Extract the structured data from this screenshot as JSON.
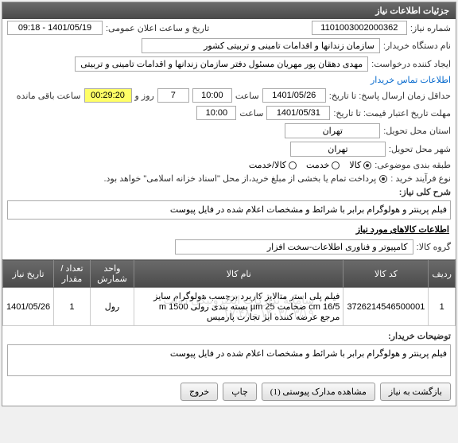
{
  "panel": {
    "title": "جزئیات اطلاعات نیاز"
  },
  "fields": {
    "need_no_lbl": "شماره نیاز:",
    "need_no": "1101003002000362",
    "announce_lbl": "تاریخ و ساعت اعلان عمومی:",
    "announce_val": "1401/05/19 - 09:18",
    "buyer_lbl": "نام دستگاه خریدار:",
    "buyer_val": "سازمان زندانها و اقدامات تامینی و تربیتی کشور",
    "creator_lbl": "ایجاد کننده درخواست:",
    "creator_val": "مهدی  دهقان پور مهریان مسئول دفتر سازمان زندانها و اقدامات تامینی و تربیتی",
    "contact_link": "اطلاعات تماس خریدار",
    "deadline_lbl": "حداقل زمان ارسال پاسخ: تا تاریخ:",
    "deadline_date": "1401/05/26",
    "time_lbl": "ساعت",
    "deadline_time": "10:00",
    "days_val": "7",
    "days_lbl": "روز و",
    "countdown": "00:29:20",
    "remain_lbl": "ساعت باقی مانده",
    "validity_lbl": "مهلت تاریخ اعتبار قیمت: تا تاریخ:",
    "validity_date": "1401/05/31",
    "validity_time": "10:00",
    "city_req_lbl": "استان محل تحویل:",
    "city_req": "تهران",
    "city_del_lbl": "شهر محل تحویل:",
    "city_del": "تهران",
    "group_lbl": "طبقه بندی موضوعی:",
    "opt_goods": "کالا",
    "opt_service": "خدمت",
    "opt_both": "کالا/خدمت",
    "buy_type_lbl": "نوع فرآیند خرید :",
    "buy_type_note": "پرداخت تمام یا بخشی از مبلغ خرید،از محل \"اسناد خزانه اسلامی\" خواهد بود.",
    "desc_lbl": "شرح کلی نیاز:",
    "desc_val": "فیلم پرینتر و هولوگرام برابر با شرائط و مشخصات اعلام شده در فایل پیوست",
    "items_title": "اطلاعات کالاهای مورد نیاز",
    "goods_group_lbl": "گروه کالا:",
    "goods_group_val": "کامپیوتر و فناوری اطلاعات-سخت افزار",
    "explain_lbl": "توضیحات خریدار:",
    "explain_val": "فیلم پرینتر و هولوگرام برابر با شرائط و مشخصات اعلام شده در فایل پیوست"
  },
  "table": {
    "headers": {
      "row": "ردیف",
      "code": "کد کالا",
      "name": "نام کالا",
      "unit": "واحد شمارش",
      "qty": "تعداد / مقدار",
      "date": "تاریخ نیاز"
    },
    "rows": [
      {
        "row": "1",
        "code": "3726214546500001",
        "name": "فیلم پلی استر متالایز کاربرد برچسب هولوگرام سایز 16/5 cm ضخامت 25 µm بسته بندی رولی 1500 m مرجع عرضه کننده ایژ تجارت پارمیس",
        "unit": "رول",
        "qty": "1",
        "date": "1401/05/26"
      }
    ],
    "watermark_top": "سامانه تدارکات الکترونیکی دولت",
    "watermark_bottom": "۱۴۰۳/۰۳/۱۹ - ۱۷:۴۸"
  },
  "buttons": {
    "back": "بازگشت به نیاز",
    "attach": "مشاهده مدارک پیوستی (1)",
    "print": "چاپ",
    "exit": "خروج"
  }
}
